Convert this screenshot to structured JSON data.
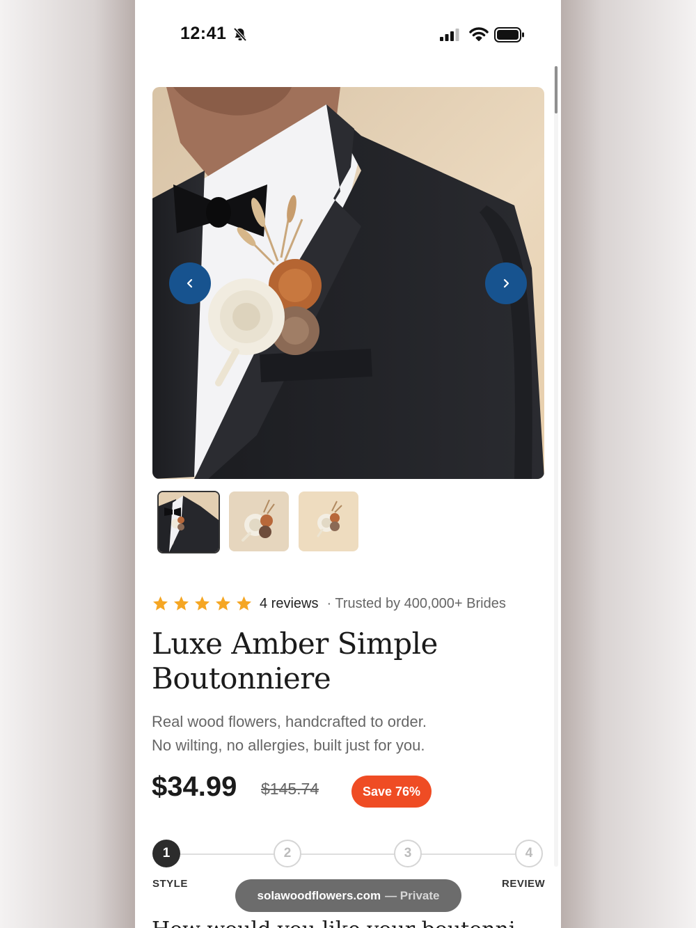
{
  "status_bar": {
    "time": "12:41"
  },
  "product": {
    "rating_stars": 5,
    "reviews_label": "4 reviews",
    "trusted_label": "· Trusted by 400,000+ Brides",
    "title_line1": "Luxe Amber Simple",
    "title_line2": "Boutonniere",
    "desc_line1": "Real wood flowers, handcrafted to order.",
    "desc_line2": "No wilting, no allergies, built just for you.",
    "price": "$34.99",
    "compare_price": "$145.74",
    "save_badge": "Save 76%"
  },
  "steps": [
    {
      "number": "1",
      "label": "STYLE",
      "active": true
    },
    {
      "number": "2",
      "label": "",
      "active": false
    },
    {
      "number": "3",
      "label": "",
      "active": false
    },
    {
      "number": "4",
      "label": "REVIEW",
      "active": false
    }
  ],
  "next_heading": "How would you like your boutonni",
  "browser": {
    "domain": "solawoodflowers.com",
    "mode": "— Private"
  },
  "colors": {
    "accent": "#17538f",
    "save": "#ef4c24",
    "star": "#f5a623"
  },
  "icons": [
    "bell-slash-icon",
    "cellular-signal-icon",
    "wifi-icon",
    "battery-icon",
    "chevron-left-icon",
    "chevron-right-icon",
    "star-icon"
  ]
}
